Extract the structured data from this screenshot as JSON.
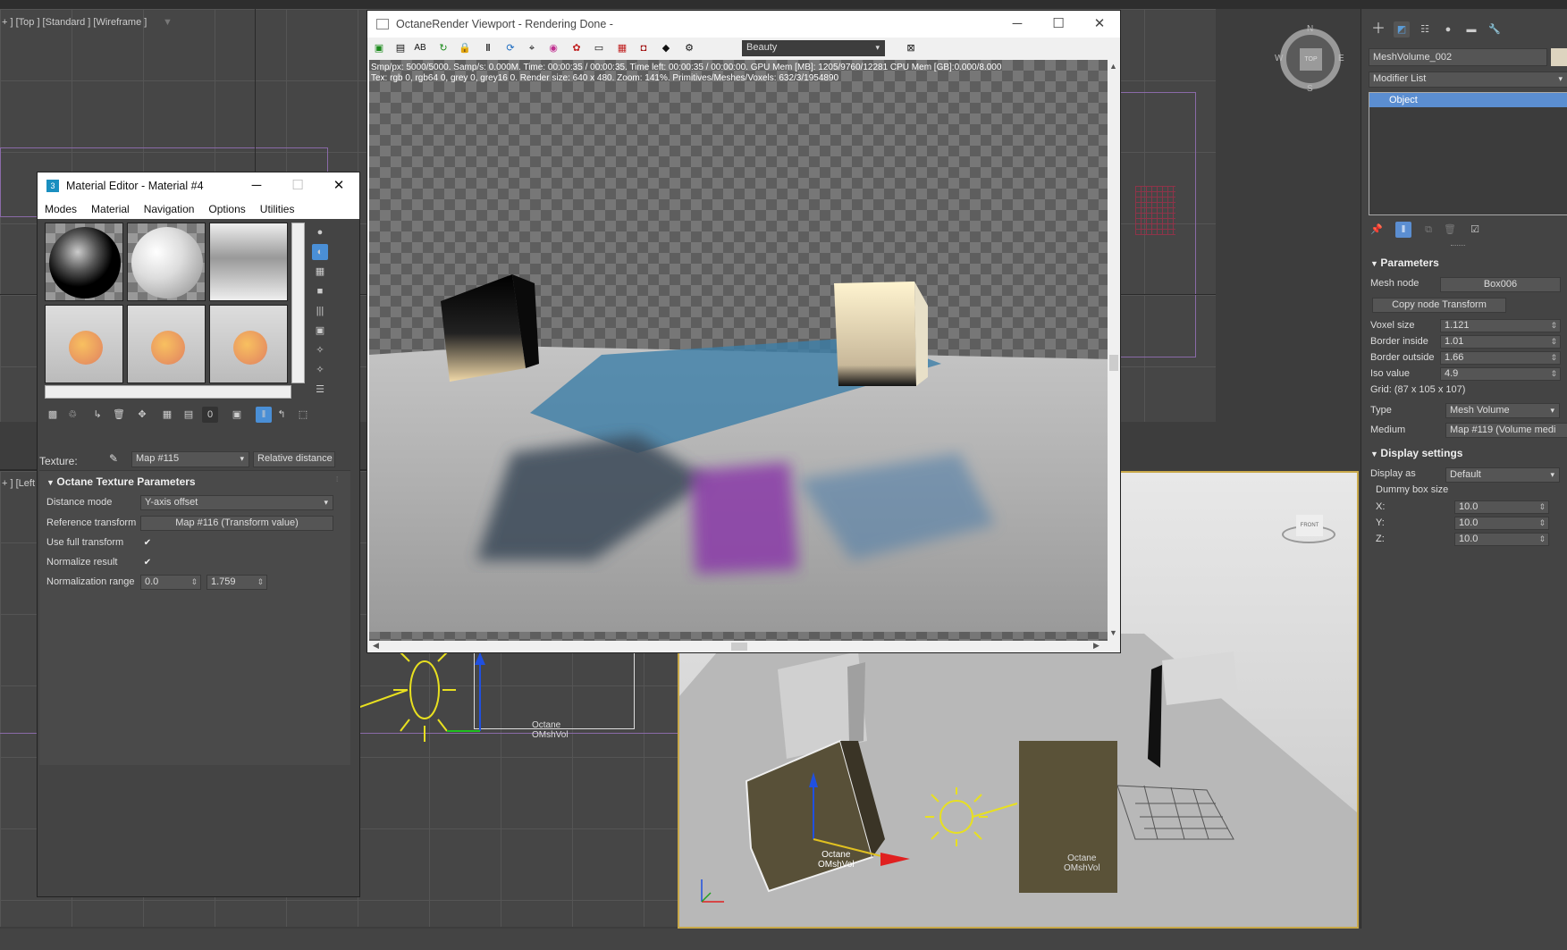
{
  "viewports": {
    "top_label": "+ ] [Top ] [Standard ] [Wireframe ]",
    "left_label": "+ ] [Left",
    "top_gizmo_letters": [
      "N",
      "W",
      "E",
      "S"
    ],
    "top_gizmo_center": "TOP",
    "front_gizmo_label": "FRONT",
    "left_objects": [
      {
        "line1": "Octane",
        "line2": "OMshVol"
      }
    ],
    "persp_objects": [
      {
        "line1": "Octane",
        "line2": "OMshVol"
      },
      {
        "line1": "Octane",
        "line2": "OMshVol"
      }
    ]
  },
  "material_editor": {
    "title": "Material Editor - Material #4",
    "menu": [
      "Modes",
      "Material",
      "Navigation",
      "Options",
      "Utilities"
    ],
    "texture_label": "Texture:",
    "texture_map": "Map #115",
    "texture_type": "Relative distance",
    "rollout_title": "Octane Texture Parameters",
    "distance_mode_label": "Distance mode",
    "distance_mode_value": "Y-axis offset",
    "reference_transform_label": "Reference transform",
    "reference_transform_value": "Map #116 (Transform value)",
    "use_full_transform_label": "Use full transform",
    "use_full_transform": true,
    "normalize_result_label": "Normalize result",
    "normalize_result": true,
    "normalization_range_label": "Normalization range",
    "normalization_min": "0.0",
    "normalization_max": "1.759",
    "check_glyph": "✔"
  },
  "octane": {
    "title": "OctaneRender Viewport - Rendering Done -",
    "toolbar_labels": [
      "AB"
    ],
    "pass_dropdown": "Beauty",
    "stats_line1": "Smp/px: 5000/5000.   Samp/s: 0.000M.   Time: 00:00:35 / 00:00:35.   Time left: 00:00:35 / 00:00:00.   GPU Mem [MB]: 1205/9760/12281   CPU Mem [GB]:0.000/8.000",
    "stats_line2": "Tex: rgb 0, rgb64 0, grey 0, grey16 0.   Render size: 640 x 480.   Zoom: 141%.   Primitives/Meshes/Voxels: 632/3/1954890"
  },
  "command_panel": {
    "object_name": "MeshVolume_002",
    "modifier_list": "Modifier List",
    "stack_item": "Object",
    "parameters_title": "Parameters",
    "mesh_node_label": "Mesh node",
    "mesh_node_value": "Box006",
    "copy_transform_button": "Copy node Transform",
    "voxel_size_label": "Voxel size",
    "voxel_size_value": "1.121",
    "border_inside_label": "Border inside",
    "border_inside_value": "1.01",
    "border_outside_label": "Border outside",
    "border_outside_value": "1.66",
    "iso_value_label": "Iso value",
    "iso_value_value": "4.9",
    "grid_text": "Grid: (87 x 105 x 107)",
    "type_label": "Type",
    "type_value": "Mesh Volume",
    "medium_label": "Medium",
    "medium_value": "Map #119 (Volume medi",
    "display_title": "Display settings",
    "display_as_label": "Display as",
    "display_as_value": "Default",
    "dummy_box_label": "Dummy box size",
    "x_label": "X:",
    "x_value": "10.0",
    "y_label": "Y:",
    "y_value": "10.0",
    "z_label": "Z:",
    "z_value": "10.0"
  },
  "colors": {
    "accent": "#4a8fd6",
    "selected": "#5b8ed1",
    "dark_panel": "#444444"
  }
}
